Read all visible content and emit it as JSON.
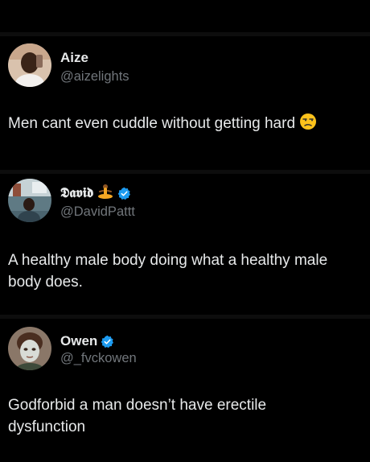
{
  "posts": [
    {
      "display_name": "Aize",
      "handle": "@aizelights",
      "verified": false,
      "text": "Men cant even cuddle without getting hard",
      "emoji_icon": "unamused-face-icon"
    },
    {
      "display_name": "𝕯𝖆𝖛𝖎𝖉",
      "handle": "@DavidPattt",
      "verified": true,
      "name_emoji_icon": "person-in-lotus-position-icon",
      "text": "A healthy male body doing what a healthy male body does."
    },
    {
      "display_name": "Owen",
      "handle": "@_fvckowen",
      "verified": true,
      "text": "Godforbid a man doesn’t have erectile dysfunction"
    }
  ],
  "colors": {
    "background": "#000000",
    "text": "#e7e9ea",
    "handle": "#71767b",
    "verified": "#1d9bf0",
    "divider": "#0d0d0d"
  }
}
